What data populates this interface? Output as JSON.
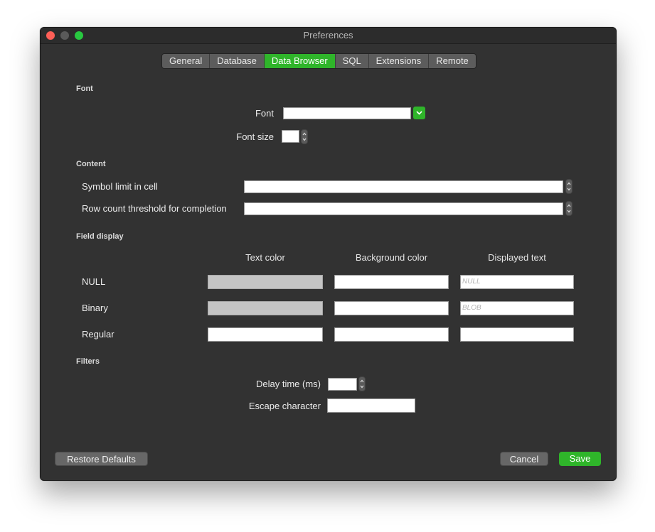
{
  "window": {
    "title": "Preferences"
  },
  "tabs": [
    {
      "label": "General"
    },
    {
      "label": "Database"
    },
    {
      "label": "Data Browser"
    },
    {
      "label": "SQL"
    },
    {
      "label": "Extensions"
    },
    {
      "label": "Remote"
    }
  ],
  "active_tab": "Data Browser",
  "font_section": {
    "heading": "Font",
    "font_label": "Font",
    "font_value": "",
    "font_size_label": "Font size",
    "font_size_value": ""
  },
  "content_section": {
    "heading": "Content",
    "symbol_limit_label": "Symbol limit in cell",
    "symbol_limit_value": "",
    "row_count_label": "Row count threshold for completion",
    "row_count_value": ""
  },
  "field_display": {
    "heading": "Field display",
    "columns": [
      "Text color",
      "Background color",
      "Displayed text"
    ],
    "rows": [
      {
        "label": "NULL",
        "displayed_placeholder": "NULL"
      },
      {
        "label": "Binary",
        "displayed_placeholder": "BLOB"
      },
      {
        "label": "Regular",
        "displayed_placeholder": ""
      }
    ]
  },
  "filters": {
    "heading": "Filters",
    "delay_label": "Delay time (ms)",
    "delay_value": "",
    "escape_label": "Escape character",
    "escape_value": ""
  },
  "buttons": {
    "restore": "Restore Defaults",
    "cancel": "Cancel",
    "save": "Save"
  },
  "colors": {
    "accent": "#2fb52a",
    "window_bg": "#323232",
    "disabled_swatch": "#c4c4c4"
  }
}
